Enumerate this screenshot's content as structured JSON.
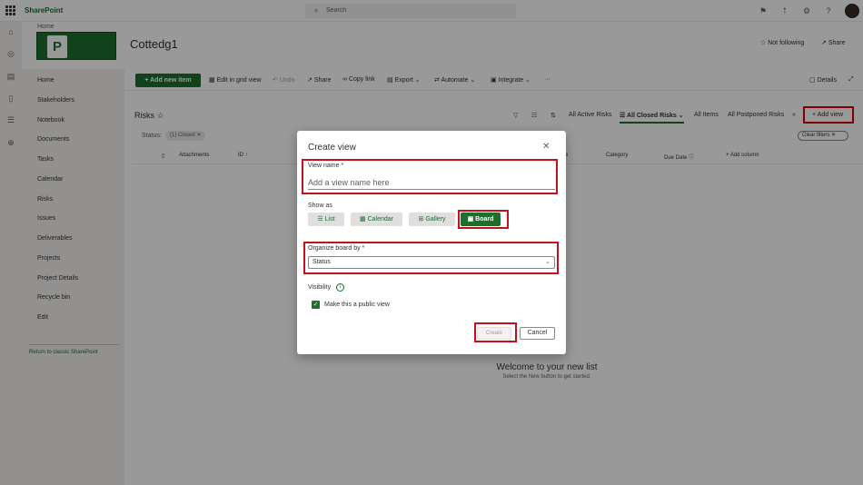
{
  "suite": {
    "brand": "SharePoint",
    "search_placeholder": "Search"
  },
  "site": {
    "breadcrumb": "Home",
    "logo_letter": "P",
    "title": "Cottedg1",
    "not_following": "Not following",
    "share": "Share"
  },
  "nav": {
    "items": [
      "Home",
      "Stakeholders",
      "Notebook",
      "Documents",
      "Tasks",
      "Calendar",
      "Risks",
      "Issues",
      "Deliverables",
      "Projects",
      "Project Details",
      "Recycle bin",
      "Edit"
    ],
    "classic_link": "Return to classic SharePoint"
  },
  "commands": {
    "new_item": "Add new item",
    "edit_grid": "Edit in grid view",
    "undo": "Undo",
    "share": "Share",
    "copy_link": "Copy link",
    "export": "Export",
    "automate": "Automate",
    "integrate": "Integrate",
    "more": "···",
    "details": "Details"
  },
  "list": {
    "title": "Risks",
    "views": {
      "active_risks": "All Active Risks",
      "closed_risks": "All Closed Risks",
      "all_items": "All Items",
      "postponed": "All Postponed Risks",
      "add_view": "Add view"
    },
    "filter": {
      "status_label": "Status:",
      "pill": "(1) Closed",
      "clear": "Clear filters"
    },
    "columns": {
      "attachments": "Attachments",
      "id": "ID",
      "status_partial": "e",
      "category": "Category",
      "due_date": "Due Date",
      "add_column": "Add column"
    },
    "welcome_title": "Welcome to your new list",
    "welcome_sub": "Select the New button to get started."
  },
  "dialog": {
    "title": "Create view",
    "view_name_label": "View name *",
    "view_name_placeholder": "Add a view name here",
    "show_as_label": "Show as",
    "show_as_options": {
      "list": "List",
      "calendar": "Calendar",
      "gallery": "Gallery",
      "board": "Board"
    },
    "selected": "Board",
    "organize_label": "Organize board by *",
    "organize_value": "Status",
    "visibility_label": "Visibility",
    "public_label": "Make this a public view",
    "public_checked": true,
    "create": "Create",
    "cancel": "Cancel"
  },
  "colors": {
    "accent": "#1f6e2d",
    "highlight": "#c50f1f"
  }
}
